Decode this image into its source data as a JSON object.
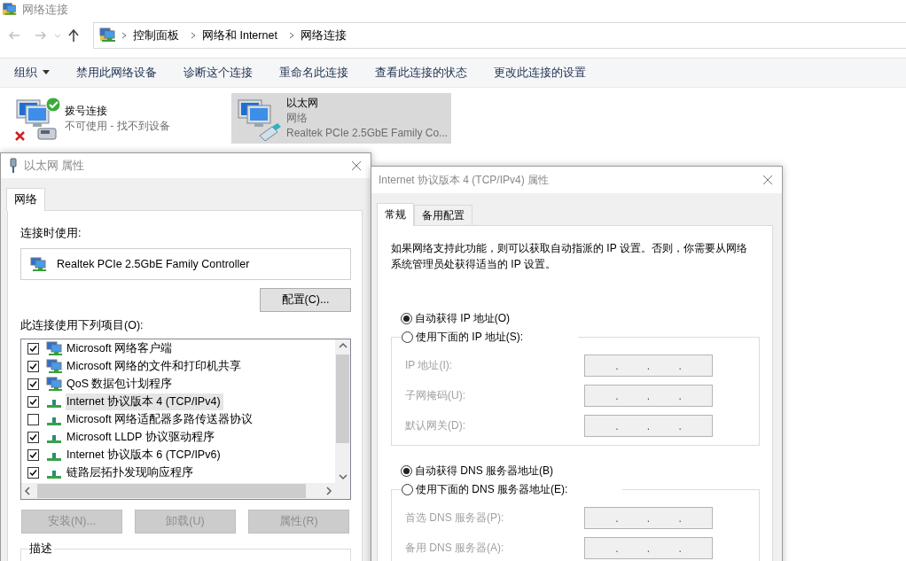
{
  "window": {
    "title": "网络连接"
  },
  "address_bar": {
    "path": [
      "控制面板",
      "网络和 Internet",
      "网络连接"
    ]
  },
  "toolbar": [
    {
      "label": "组织",
      "kind": "menu"
    },
    {
      "label": "禁用此网络设备",
      "kind": "command"
    },
    {
      "label": "诊断这个连接",
      "kind": "command"
    },
    {
      "label": "重命名此连接",
      "kind": "command"
    },
    {
      "label": "查看此连接的状态",
      "kind": "command"
    },
    {
      "label": "更改此连接的设置",
      "kind": "command"
    }
  ],
  "connections": [
    {
      "name": "拨号连接",
      "status": "不可使用 - 找不到设备",
      "kind": "dialup",
      "selected": false
    },
    {
      "name": "以太网",
      "status": "网络",
      "device": "Realtek PCIe 2.5GbE Family Co...",
      "kind": "ethernet",
      "selected": true
    }
  ],
  "ethernet_properties": {
    "title": "以太网 属性",
    "tabs": [
      {
        "label": "网络",
        "selected": true
      }
    ],
    "connect_using_label": "连接时使用:",
    "adapter": "Realtek PCIe 2.5GbE Family Controller",
    "configure_button": "配置(C)...",
    "components_label": "此连接使用下列项目(O):",
    "components": [
      {
        "label": "Microsoft 网络客户端",
        "kind": "client",
        "checked": true,
        "selected": false
      },
      {
        "label": "Microsoft 网络的文件和打印机共享",
        "kind": "client",
        "checked": true,
        "selected": false
      },
      {
        "label": "QoS 数据包计划程序",
        "kind": "client",
        "checked": true,
        "selected": false
      },
      {
        "label": "Internet 协议版本 4 (TCP/IPv4)",
        "kind": "protocol",
        "checked": true,
        "selected": true
      },
      {
        "label": "Microsoft 网络适配器多路传送器协议",
        "kind": "protocol",
        "checked": false,
        "selected": false
      },
      {
        "label": "Microsoft LLDP 协议驱动程序",
        "kind": "protocol",
        "checked": true,
        "selected": false
      },
      {
        "label": "Internet 协议版本 6 (TCP/IPv6)",
        "kind": "protocol",
        "checked": true,
        "selected": false
      },
      {
        "label": "链路层拓扑发现响应程序",
        "kind": "protocol",
        "checked": true,
        "selected": false
      }
    ],
    "buttons": [
      {
        "label": "安装(N)...",
        "disabled": true
      },
      {
        "label": "卸载(U)",
        "disabled": true
      },
      {
        "label": "属性(R)",
        "disabled": true
      }
    ],
    "description_label": "描述"
  },
  "ipv4_properties": {
    "title": "Internet 协议版本 4 (TCP/IPv4) 属性",
    "tabs": [
      {
        "label": "常规",
        "selected": true
      },
      {
        "label": "备用配置",
        "selected": false
      }
    ],
    "intro": "如果网络支持此功能，则可以获取自动指派的 IP 设置。否则，你需要从网络系统管理员处获得适当的 IP 设置。",
    "ip_modes": [
      {
        "label": "自动获得 IP 地址(O)",
        "selected": true
      },
      {
        "label": "使用下面的 IP 地址(S):",
        "selected": false
      }
    ],
    "ip_fields": [
      {
        "label": "IP 地址(I):",
        "value": ". . .",
        "disabled": true
      },
      {
        "label": "子网掩码(U):",
        "value": ". . .",
        "disabled": true
      },
      {
        "label": "默认网关(D):",
        "value": ". . .",
        "disabled": true
      }
    ],
    "dns_modes": [
      {
        "label": "自动获得 DNS 服务器地址(B)",
        "selected": true
      },
      {
        "label": "使用下面的 DNS 服务器地址(E):",
        "selected": false
      }
    ],
    "dns_fields": [
      {
        "label": "首选 DNS 服务器(P):",
        "value": ". . .",
        "disabled": true
      },
      {
        "label": "备用 DNS 服务器(A):",
        "value": ". . .",
        "disabled": true
      }
    ]
  }
}
